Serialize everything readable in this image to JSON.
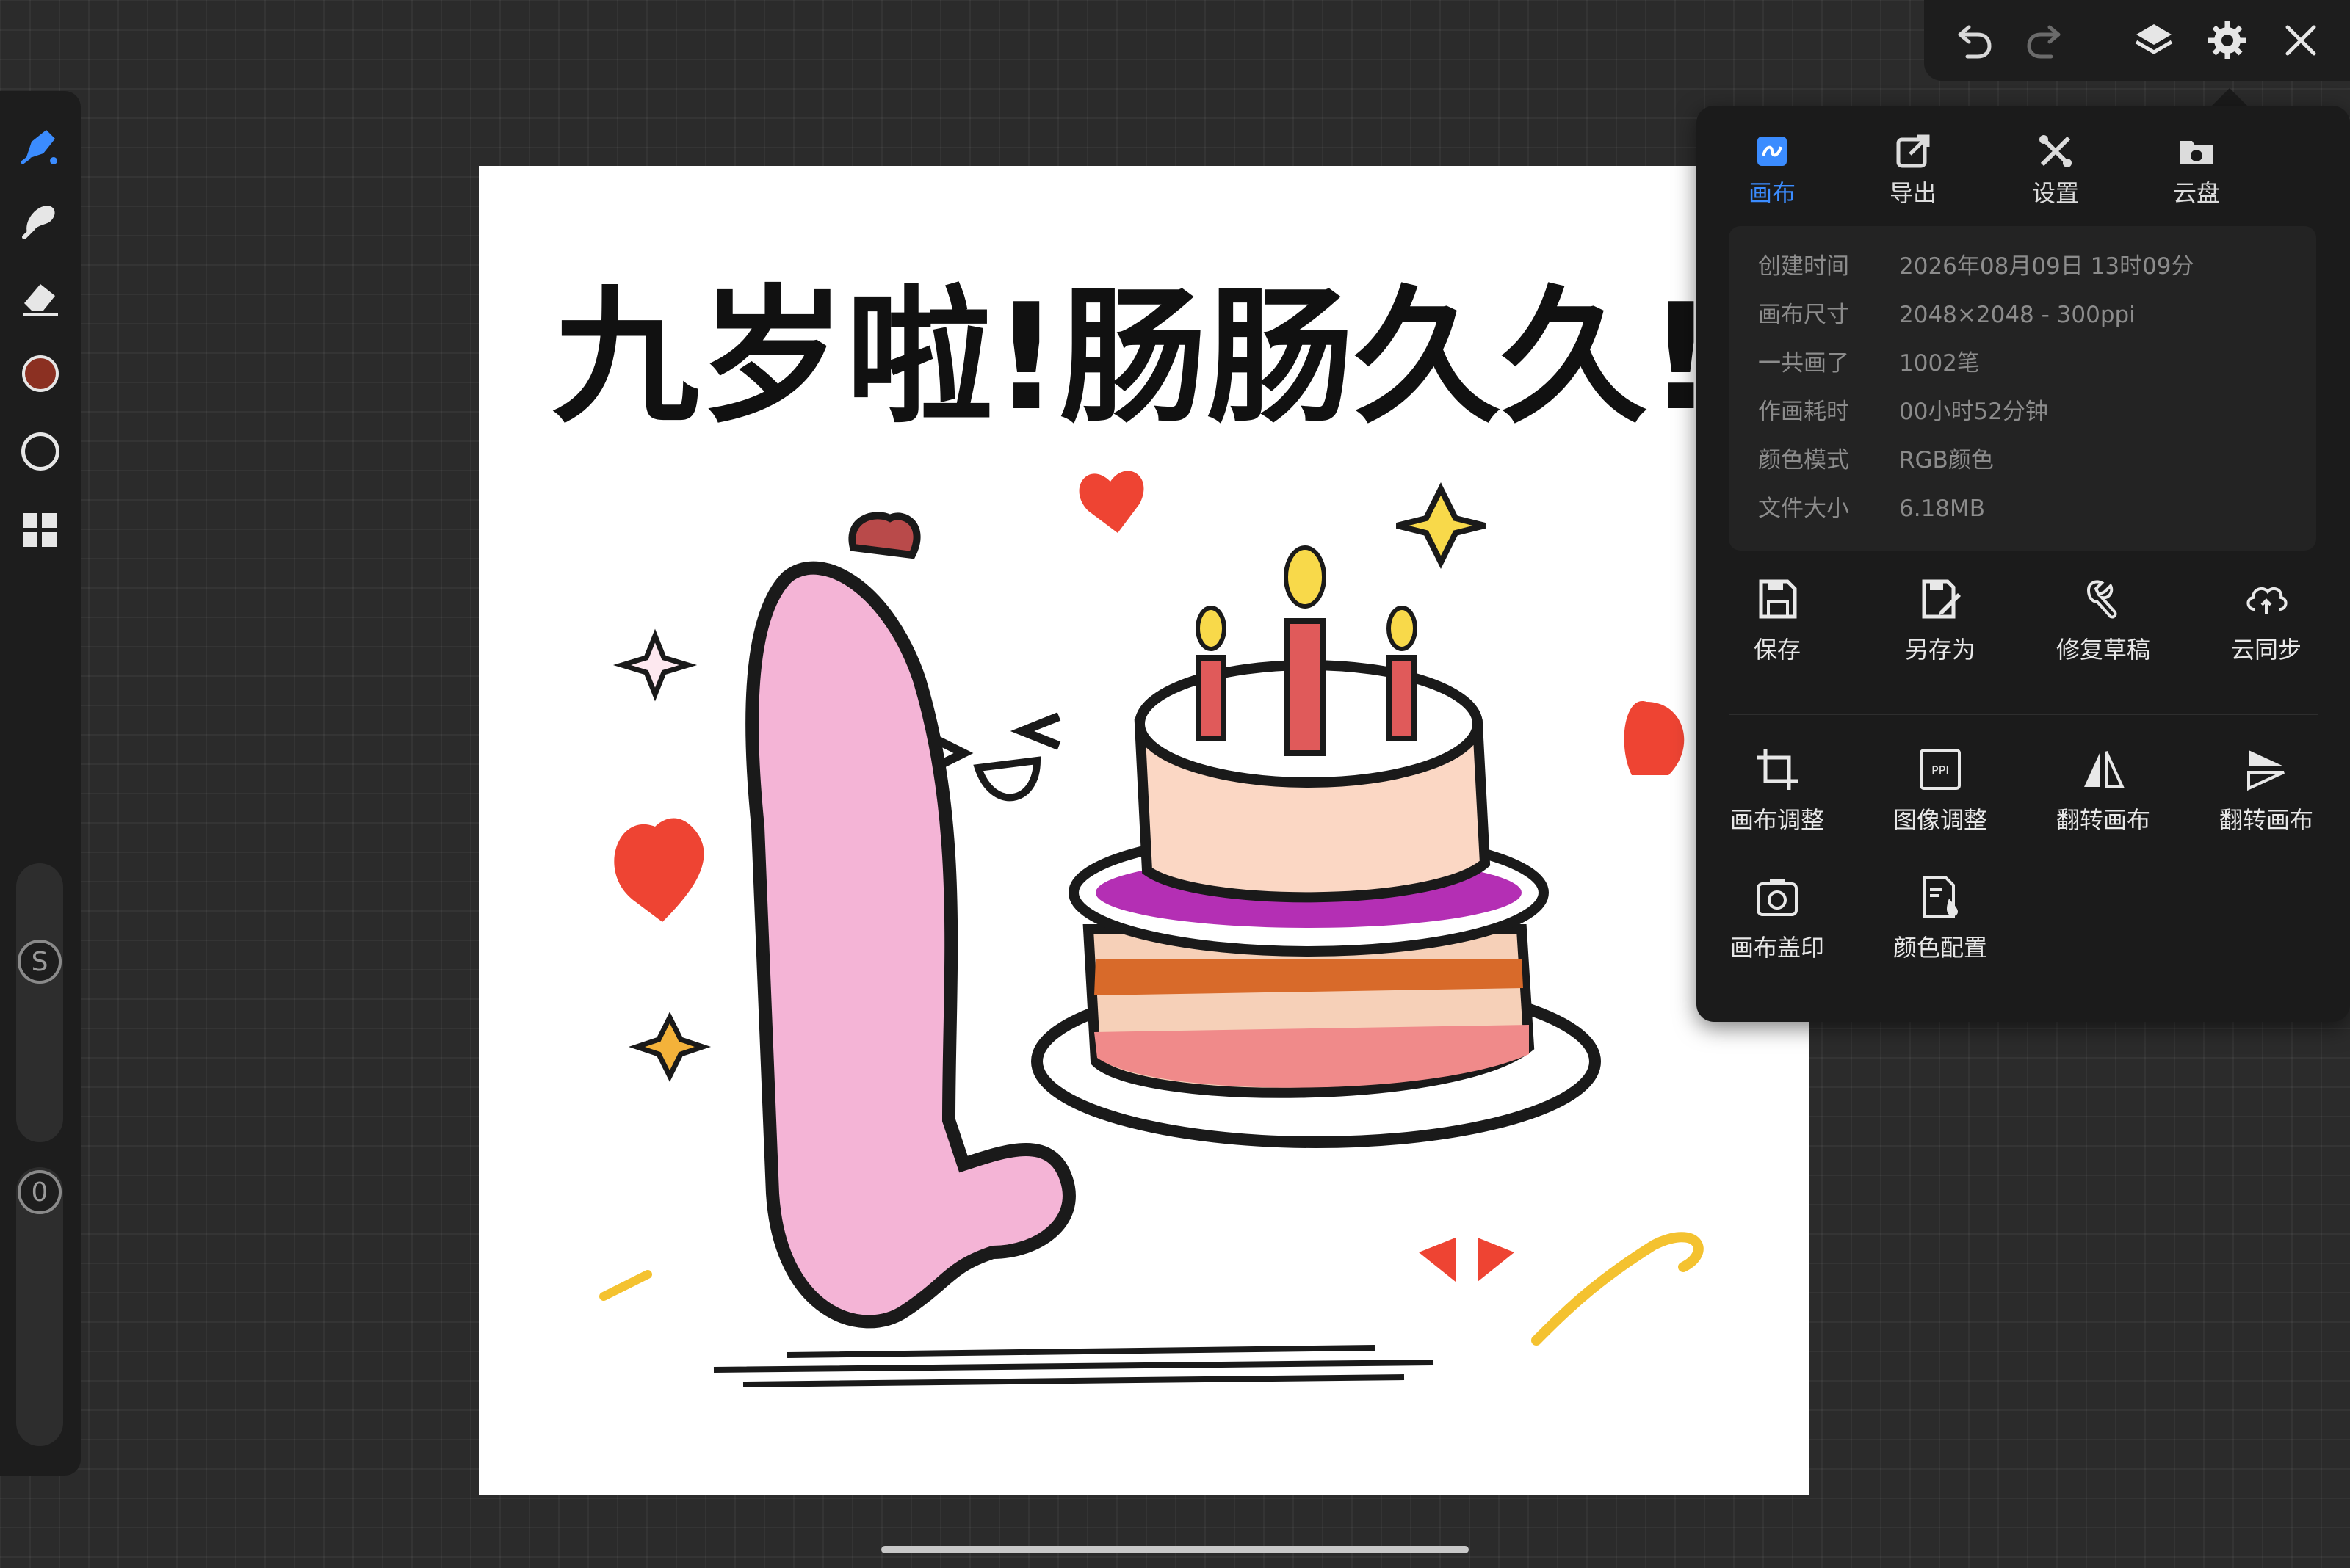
{
  "left_toolbar": {
    "tools": [
      {
        "name": "brush-icon"
      },
      {
        "name": "smudge-icon"
      },
      {
        "name": "eraser-icon"
      },
      {
        "name": "color-swatch"
      },
      {
        "name": "selection-circle"
      },
      {
        "name": "gallery-icon"
      }
    ],
    "current_color": "#8b3022",
    "size_slider_label": "S",
    "opacity_slider_label": "0"
  },
  "top_bar": {
    "buttons": [
      "undo-icon",
      "redo-icon",
      "layers-icon",
      "gear-icon",
      "close-icon"
    ]
  },
  "panel": {
    "tabs": [
      {
        "label": "画布",
        "active": true
      },
      {
        "label": "导出",
        "active": false
      },
      {
        "label": "设置",
        "active": false
      },
      {
        "label": "云盘",
        "active": false
      }
    ],
    "info": [
      {
        "key": "创建时间",
        "value": "2026年08月09日 13时09分"
      },
      {
        "key": "画布尺寸",
        "value": "2048×2048 - 300ppi"
      },
      {
        "key": "一共画了",
        "value": "1002笔"
      },
      {
        "key": "作画耗时",
        "value": "00小时52分钟"
      },
      {
        "key": "颜色模式",
        "value": "RGB颜色"
      },
      {
        "key": "文件大小",
        "value": "6.18MB"
      }
    ],
    "actions_row1": [
      {
        "label": "保存",
        "icon": "save-icon"
      },
      {
        "label": "另存为",
        "icon": "save-as-icon"
      },
      {
        "label": "修复草稿",
        "icon": "repair-icon"
      },
      {
        "label": "云同步",
        "icon": "cloud-sync-icon"
      }
    ],
    "actions_row2": [
      {
        "label": "画布调整",
        "icon": "crop-icon"
      },
      {
        "label": "图像调整",
        "icon": "ppi-icon"
      },
      {
        "label": "翻转画布",
        "icon": "flip-horizontal-icon"
      },
      {
        "label": "翻转画布",
        "icon": "flip-vertical-icon"
      }
    ],
    "actions_row3": [
      {
        "label": "画布盖印",
        "icon": "stamp-camera-icon"
      },
      {
        "label": "颜色配置",
        "icon": "color-profile-icon"
      }
    ]
  },
  "artwork": {
    "caption": "九岁啦!肠肠久久!"
  },
  "colors": {
    "accent": "#3b8cff",
    "panel_bg": "#1b1b1b",
    "canvas_bg": "#ffffff"
  }
}
